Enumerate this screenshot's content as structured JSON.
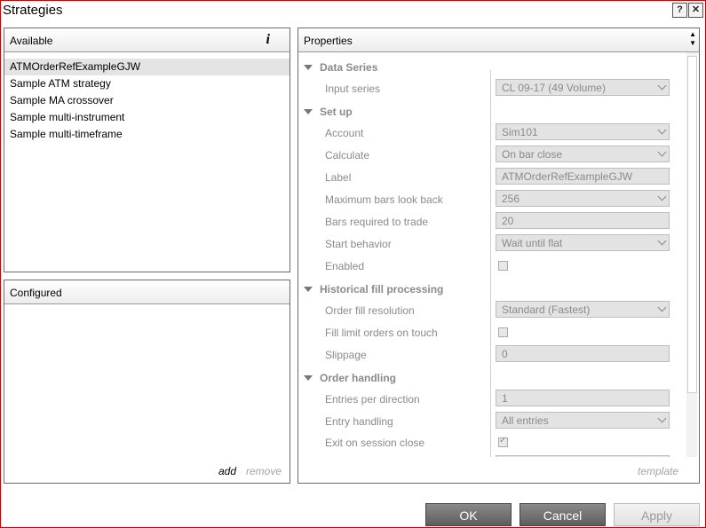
{
  "window": {
    "title": "Strategies",
    "help": "?",
    "close": "✕"
  },
  "available": {
    "header": "Available",
    "info_icon": "i",
    "items": [
      "ATMOrderRefExampleGJW",
      "Sample ATM strategy",
      "Sample MA crossover",
      "Sample multi-instrument",
      "Sample multi-timeframe"
    ],
    "selected_index": 0
  },
  "configured": {
    "header": "Configured",
    "add": "add",
    "remove": "remove"
  },
  "properties": {
    "header": "Properties",
    "template": "template",
    "categories": [
      {
        "name": "Data Series",
        "rows": [
          {
            "label": "Input series",
            "value": "CL 09-17 (49 Volume)",
            "kind": "select"
          }
        ]
      },
      {
        "name": "Set up",
        "rows": [
          {
            "label": "Account",
            "value": "Sim101",
            "kind": "select"
          },
          {
            "label": "Calculate",
            "value": "On bar close",
            "kind": "select"
          },
          {
            "label": "Label",
            "value": "ATMOrderRefExampleGJW",
            "kind": "text"
          },
          {
            "label": "Maximum bars look back",
            "value": "256",
            "kind": "select"
          },
          {
            "label": "Bars required to trade",
            "value": "20",
            "kind": "text"
          },
          {
            "label": "Start behavior",
            "value": "Wait until flat",
            "kind": "select"
          },
          {
            "label": "Enabled",
            "value": false,
            "kind": "check"
          }
        ]
      },
      {
        "name": "Historical fill processing",
        "rows": [
          {
            "label": "Order fill resolution",
            "value": "Standard (Fastest)",
            "kind": "select"
          },
          {
            "label": "Fill limit orders on touch",
            "value": false,
            "kind": "check"
          },
          {
            "label": "Slippage",
            "value": "0",
            "kind": "text"
          }
        ]
      },
      {
        "name": "Order handling",
        "rows": [
          {
            "label": "Entries per direction",
            "value": "1",
            "kind": "text"
          },
          {
            "label": "Entry handling",
            "value": "All entries",
            "kind": "select"
          },
          {
            "label": "Exit on session close",
            "value": true,
            "kind": "check"
          }
        ]
      }
    ]
  },
  "buttons": {
    "ok": "OK",
    "cancel": "Cancel",
    "apply": "Apply"
  },
  "colors": {
    "frame": "#d00000",
    "button": "#6e6e6e",
    "disabled": "#e6e6e6"
  }
}
